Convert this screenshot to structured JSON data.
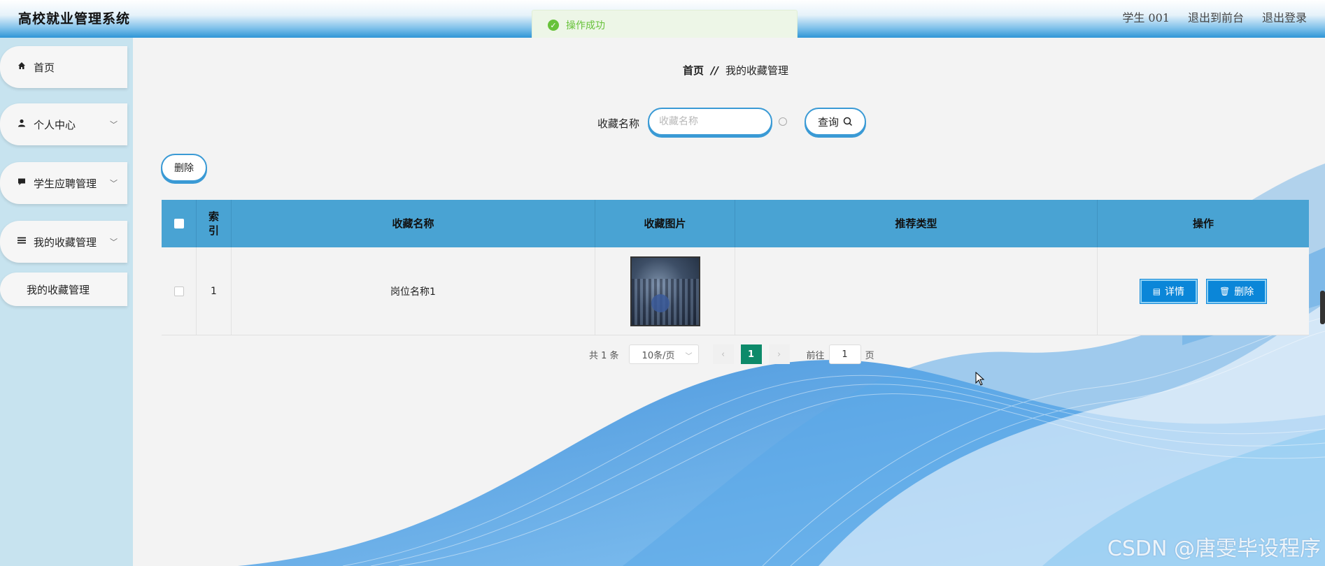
{
  "header": {
    "app_title": "高校就业管理系统",
    "user_label": "学生 001",
    "to_front_label": "退出到前台",
    "logout_label": "退出登录"
  },
  "toast": {
    "message": "操作成功",
    "icon": "check-circle-icon"
  },
  "sidebar": {
    "items": [
      {
        "label": "首页",
        "icon": "home-icon"
      },
      {
        "label": "个人中心",
        "icon": "user-icon"
      },
      {
        "label": "学生应聘管理",
        "icon": "message-icon"
      },
      {
        "label": "我的收藏管理",
        "icon": "menu-icon"
      }
    ],
    "sub_item": "我的收藏管理"
  },
  "breadcrumb": {
    "home": "首页",
    "separator": "//",
    "current": "我的收藏管理"
  },
  "search": {
    "label": "收藏名称",
    "placeholder": "收藏名称",
    "value": "",
    "query_label": "查询"
  },
  "toolbar": {
    "delete_label": "删除"
  },
  "table": {
    "headers": [
      "索引",
      "收藏名称",
      "收藏图片",
      "推荐类型",
      "操作"
    ],
    "rows": [
      {
        "index": "1",
        "name": "岗位名称1",
        "image": "classroom-photo",
        "type": ""
      }
    ],
    "detail_label": "详情",
    "delete_label": "删除"
  },
  "pagination": {
    "total_text": "共 1 条",
    "page_size": "10条/页",
    "current_page": "1",
    "goto_prefix": "前往",
    "goto_value": "1",
    "goto_suffix": "页"
  },
  "watermark": "CSDN @唐雯毕设程序",
  "colors": {
    "accent": "#3a9ad5",
    "table_header": "#49a3d3",
    "button": "#0b86d8",
    "page_active": "#0d8a6a",
    "success": "#67c23a",
    "sidebar": "#c7e3ef"
  }
}
